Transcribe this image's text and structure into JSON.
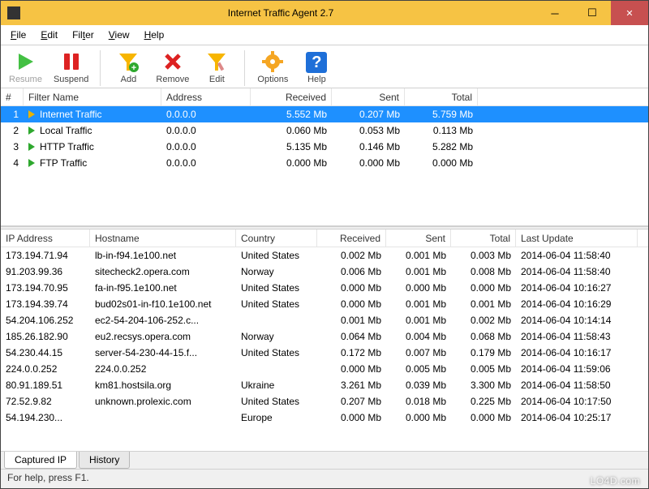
{
  "window": {
    "title": "Internet Traffic Agent 2.7"
  },
  "menu": {
    "file": "File",
    "edit": "Edit",
    "filter": "Filter",
    "view": "View",
    "help": "Help"
  },
  "toolbar": {
    "resume": "Resume",
    "suspend": "Suspend",
    "add": "Add",
    "remove": "Remove",
    "edit": "Edit",
    "options": "Options",
    "help": "Help"
  },
  "filters": {
    "headers": {
      "idx": "#",
      "name": "Filter Name",
      "address": "Address",
      "received": "Received",
      "sent": "Sent",
      "total": "Total"
    },
    "rows": [
      {
        "idx": "1",
        "name": "Internet Traffic",
        "address": "0.0.0.0",
        "received": "5.552 Mb",
        "sent": "0.207 Mb",
        "total": "5.759 Mb",
        "selected": true
      },
      {
        "idx": "2",
        "name": "Local Traffic",
        "address": "0.0.0.0",
        "received": "0.060 Mb",
        "sent": "0.053 Mb",
        "total": "0.113 Mb"
      },
      {
        "idx": "3",
        "name": "HTTP Traffic",
        "address": "0.0.0.0",
        "received": "5.135 Mb",
        "sent": "0.146 Mb",
        "total": "5.282 Mb"
      },
      {
        "idx": "4",
        "name": "FTP Traffic",
        "address": "0.0.0.0",
        "received": "0.000 Mb",
        "sent": "0.000 Mb",
        "total": "0.000 Mb"
      }
    ]
  },
  "captured": {
    "headers": {
      "ip": "IP Address",
      "host": "Hostname",
      "country": "Country",
      "received": "Received",
      "sent": "Sent",
      "total": "Total",
      "updated": "Last Update"
    },
    "rows": [
      {
        "ip": "173.194.71.94",
        "host": "lb-in-f94.1e100.net",
        "country": "United States",
        "received": "0.002 Mb",
        "sent": "0.001 Mb",
        "total": "0.003 Mb",
        "updated": "2014-06-04  11:58:40"
      },
      {
        "ip": "91.203.99.36",
        "host": "sitecheck2.opera.com",
        "country": "Norway",
        "received": "0.006 Mb",
        "sent": "0.001 Mb",
        "total": "0.008 Mb",
        "updated": "2014-06-04  11:58:40"
      },
      {
        "ip": "173.194.70.95",
        "host": "fa-in-f95.1e100.net",
        "country": "United States",
        "received": "0.000 Mb",
        "sent": "0.000 Mb",
        "total": "0.000 Mb",
        "updated": "2014-06-04  10:16:27"
      },
      {
        "ip": "173.194.39.74",
        "host": "bud02s01-in-f10.1e100.net",
        "country": "United States",
        "received": "0.000 Mb",
        "sent": "0.001 Mb",
        "total": "0.001 Mb",
        "updated": "2014-06-04  10:16:29"
      },
      {
        "ip": "54.204.106.252",
        "host": "ec2-54-204-106-252.c...",
        "country": "",
        "received": "0.001 Mb",
        "sent": "0.001 Mb",
        "total": "0.002 Mb",
        "updated": "2014-06-04  10:14:14"
      },
      {
        "ip": "185.26.182.90",
        "host": "eu2.recsys.opera.com",
        "country": "Norway",
        "received": "0.064 Mb",
        "sent": "0.004 Mb",
        "total": "0.068 Mb",
        "updated": "2014-06-04  11:58:43"
      },
      {
        "ip": "54.230.44.15",
        "host": "server-54-230-44-15.f...",
        "country": "United States",
        "received": "0.172 Mb",
        "sent": "0.007 Mb",
        "total": "0.179 Mb",
        "updated": "2014-06-04  10:16:17"
      },
      {
        "ip": "224.0.0.252",
        "host": "224.0.0.252",
        "country": "",
        "received": "0.000 Mb",
        "sent": "0.005 Mb",
        "total": "0.005 Mb",
        "updated": "2014-06-04  11:59:06"
      },
      {
        "ip": "80.91.189.51",
        "host": "km81.hostsila.org",
        "country": "Ukraine",
        "received": "3.261 Mb",
        "sent": "0.039 Mb",
        "total": "3.300 Mb",
        "updated": "2014-06-04  11:58:50"
      },
      {
        "ip": "72.52.9.82",
        "host": "unknown.prolexic.com",
        "country": "United States",
        "received": "0.207 Mb",
        "sent": "0.018 Mb",
        "total": "0.225 Mb",
        "updated": "2014-06-04  10:17:50"
      },
      {
        "ip": "54.194.230...",
        "host": "",
        "country": "Europe",
        "received": "0.000 Mb",
        "sent": "0.000 Mb",
        "total": "0.000 Mb",
        "updated": "2014-06-04  10:25:17"
      }
    ]
  },
  "tabs": {
    "captured": "Captured IP",
    "history": "History"
  },
  "statusbar": "For help, press F1.",
  "watermark": "LO4D.com"
}
